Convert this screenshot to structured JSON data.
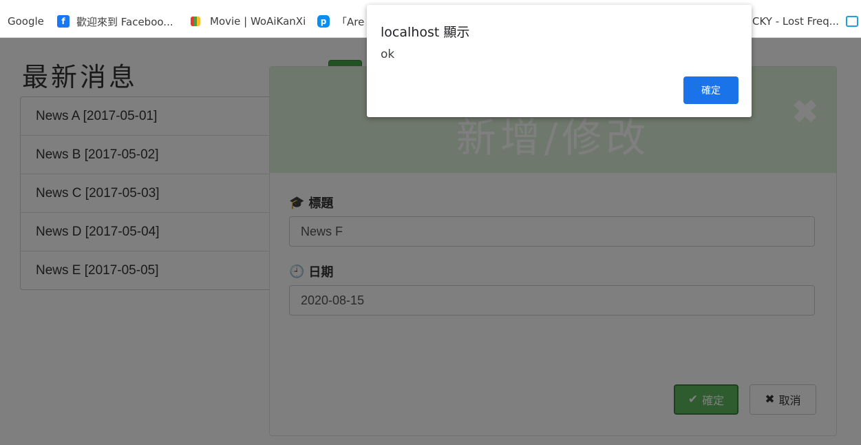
{
  "bookmarks": [
    {
      "label": "Google",
      "icon": "none"
    },
    {
      "label": "歡迎來到 Faceboo...",
      "icon": "facebook-icon"
    },
    {
      "label": "Movie | WoAiKanXi",
      "icon": "movie-icon"
    },
    {
      "label": "「Are",
      "icon": "p-icon"
    },
    {
      "label": "CKY - Lost Freq...",
      "icon": "none"
    }
  ],
  "page": {
    "title": "最新消息",
    "add_label": "+",
    "edit_glyph": "✎",
    "delete_glyph": "✖",
    "news": [
      {
        "label": "News A [2017-05-01]"
      },
      {
        "label": "News B [2017-05-02]"
      },
      {
        "label": "News C [2017-05-03]"
      },
      {
        "label": "News D [2017-05-04]"
      },
      {
        "label": "News E [2017-05-05]"
      }
    ]
  },
  "modal": {
    "title": "新增/修改",
    "close_glyph": "✖",
    "title_field_label": "標題",
    "title_field_value": "News F",
    "date_field_label": "日期",
    "date_field_value": "2020-08-15",
    "confirm_label": "確定",
    "cancel_label": "取消"
  },
  "dialog": {
    "title": "localhost 顯示",
    "message": "ok",
    "ok_label": "確定"
  },
  "colors": {
    "add_green": "#44a348",
    "edit_teal": "#36a9c9",
    "delete_red": "#d9534f",
    "modal_header": "#dff0d8",
    "dialog_button": "#1a73e8"
  }
}
